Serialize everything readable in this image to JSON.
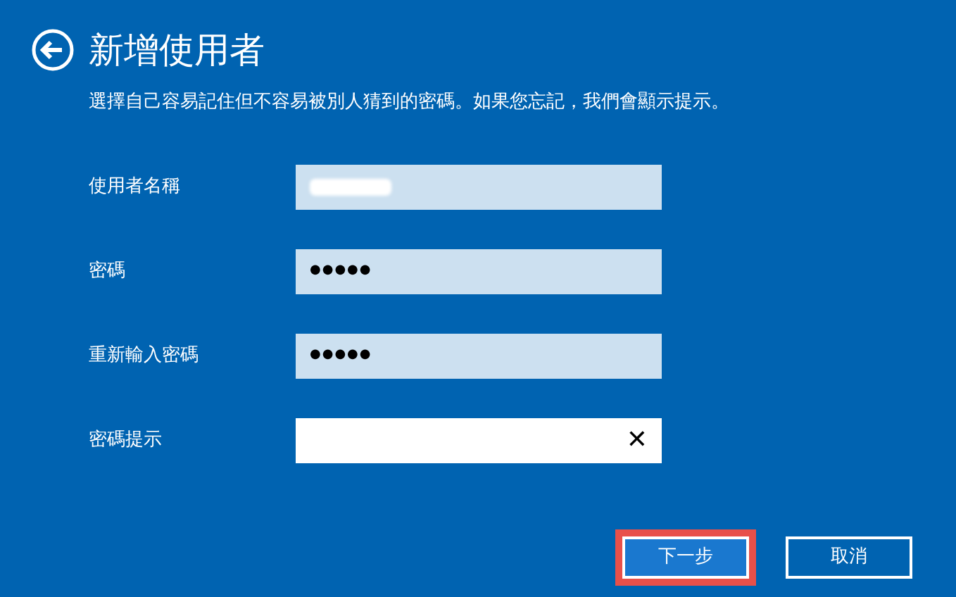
{
  "title": "新增使用者",
  "instruction": "選擇自己容易記住但不容易被別人猜到的密碼。如果您忘記，我們會顯示提示。",
  "fields": [
    {
      "label": "使用者名稱",
      "redacted": true,
      "focused": false
    },
    {
      "label": "密碼",
      "value": "●●●●●",
      "focused": false
    },
    {
      "label": "重新輸入密碼",
      "value": "●●●●●",
      "focused": false
    },
    {
      "label": "密碼提示",
      "focused": true,
      "clear": "✕"
    }
  ],
  "buttons": [
    {
      "label": "下一步",
      "kind": "primary",
      "highlighted": true
    },
    {
      "label": "取消",
      "kind": "secondary",
      "highlighted": false
    }
  ]
}
